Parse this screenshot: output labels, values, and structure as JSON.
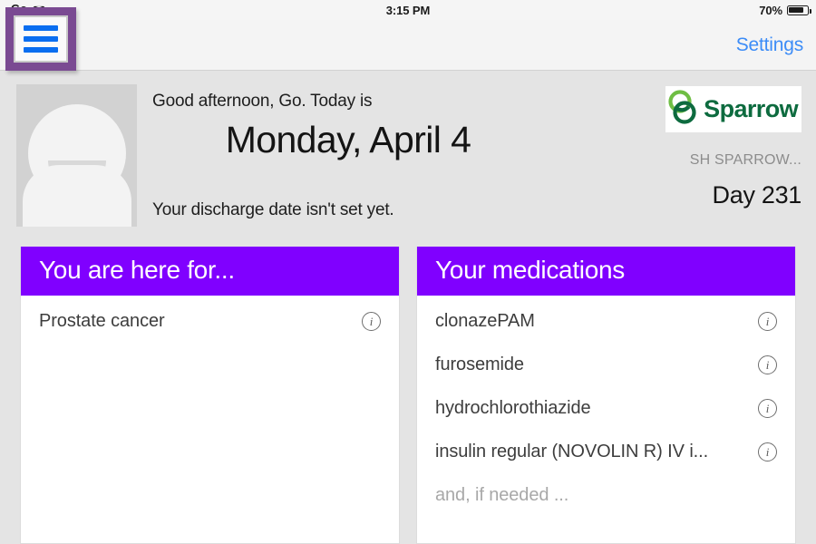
{
  "status_bar": {
    "carrier": "Go",
    "wifi_icon": "wifi-icon",
    "time": "3:15 PM",
    "battery_percent": "70%",
    "battery_icon": "battery-icon"
  },
  "nav_bar": {
    "menu_icon": "hamburger-menu-icon",
    "settings_label": "Settings"
  },
  "header": {
    "avatar_icon": "person-placeholder-avatar",
    "greeting": "Good afternoon, Go. Today is",
    "date": "Monday, April 4",
    "discharge_note": "Your discharge date isn't set yet."
  },
  "brand": {
    "logo_icon": "sparrow-interlocking-rings-logo",
    "name": "Sparrow",
    "organization": "SH SPARROW...",
    "day_counter": "Day 231",
    "logo_green_light": "#6fbe44",
    "logo_green_dark": "#0d6b3f"
  },
  "cards": [
    {
      "title": "You are here for...",
      "items": [
        {
          "label": "Prostate cancer",
          "info_icon": "info-icon",
          "muted": false
        }
      ]
    },
    {
      "title": "Your medications",
      "items": [
        {
          "label": "clonazePAM",
          "info_icon": "info-icon",
          "muted": false
        },
        {
          "label": "furosemide",
          "info_icon": "info-icon",
          "muted": false
        },
        {
          "label": "hydrochlorothiazide",
          "info_icon": "info-icon",
          "muted": false
        },
        {
          "label": "insulin regular (NOVOLIN R) IV i...",
          "info_icon": "info-icon",
          "muted": false
        },
        {
          "label": "and, if needed ...",
          "info_icon": null,
          "muted": true
        }
      ]
    }
  ],
  "colors": {
    "accent_purple": "#8000ff",
    "link_blue": "#3c8cf7",
    "page_background": "#e4e4e4",
    "highlight_ring": "#7a4a92"
  }
}
